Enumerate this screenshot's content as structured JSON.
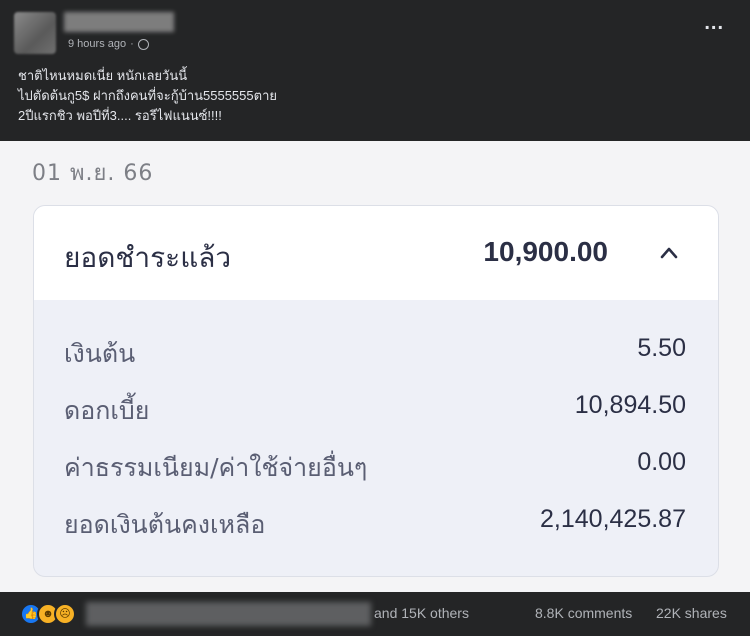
{
  "post": {
    "time": "9 hours ago",
    "visibility_separator": "·",
    "more": "...",
    "caption": [
      "ชาติไหนหมดเนี่ย หนักเลยวันนี้",
      "ไปตัดต้นกู5$ ฝากถึงคนที่จะกู้บ้าน5555555ตาย",
      "2ปีแรกชิว พอปีที่3.... รอรีไฟแนนซ์!!!!"
    ]
  },
  "statement": {
    "date": "01 พ.ย. 66",
    "paid_label": "ยอดชำระแล้ว",
    "paid_amount": "10,900.00",
    "rows": [
      {
        "label": "เงินต้น",
        "value": "5.50"
      },
      {
        "label": "ดอกเบี้ย",
        "value": "10,894.50"
      },
      {
        "label": "ค่าธรรมเนียม/ค่าใช้จ่ายอื่นๆ",
        "value": "0.00"
      },
      {
        "label": "ยอดเงินต้นคงเหลือ",
        "value": "2,140,425.87"
      }
    ]
  },
  "footer": {
    "reaction_icons": [
      "like-icon",
      "haha-icon",
      "wow-icon"
    ],
    "others": "and 15K others",
    "comments": "8.8K comments",
    "shares": "22K shares"
  }
}
